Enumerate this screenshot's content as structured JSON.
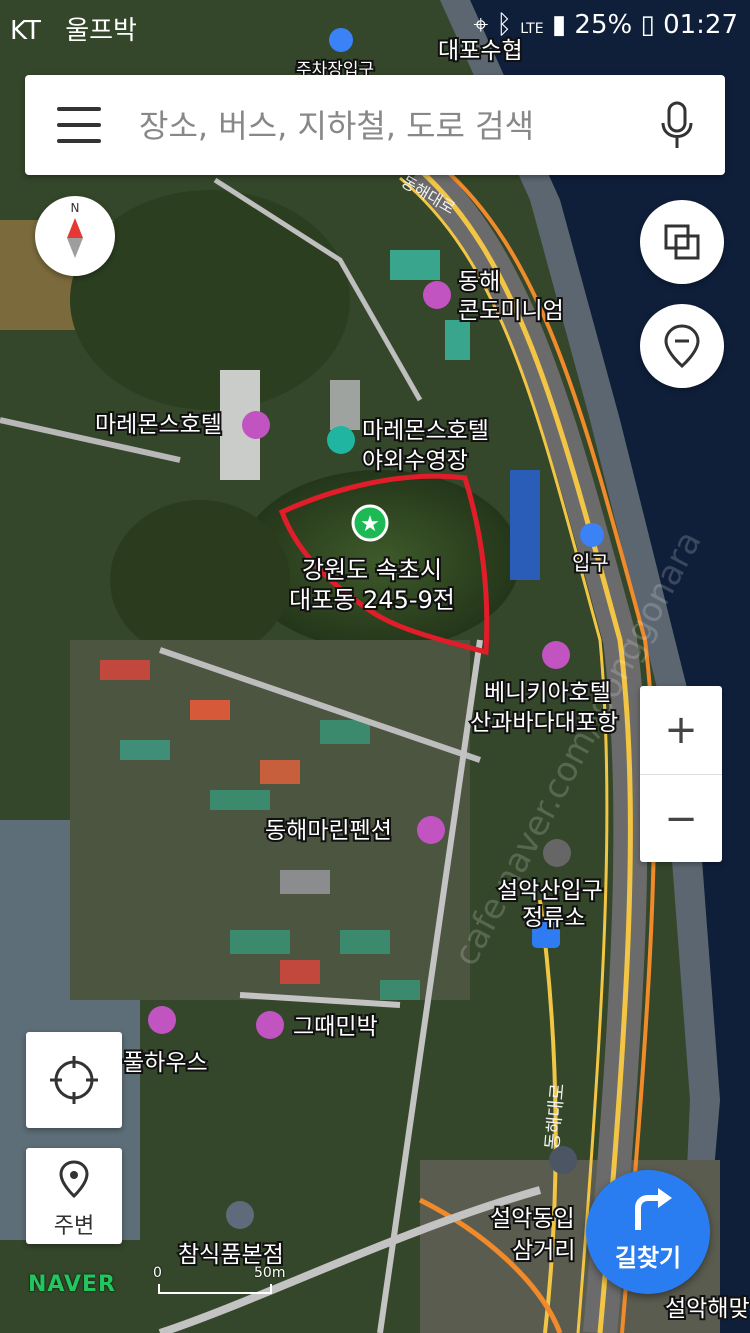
{
  "status_bar": {
    "carrier": "KT",
    "notification": "울프박",
    "network": "LTE",
    "battery": "25%",
    "time": "01:27"
  },
  "search": {
    "placeholder": "장소, 버스, 지하철, 도로 검색"
  },
  "buttons": {
    "nearby": "주변",
    "directions": "길찾기",
    "zoom_in": "+",
    "zoom_out": "−"
  },
  "map": {
    "target_address_line1": "강원도 속초시",
    "target_address_line2": "대포동 245-9전",
    "places": [
      {
        "id": "parking",
        "label": "주차장입구",
        "icon": "parking-icon"
      },
      {
        "id": "daepo",
        "label": "대포수협",
        "icon": "none"
      },
      {
        "id": "donghae-condo-1",
        "label": "동해",
        "icon": "lodging-icon"
      },
      {
        "id": "donghae-condo-2",
        "label": "콘도미니엄",
        "icon": "none"
      },
      {
        "id": "maremons-hotel",
        "label": "마레몬스호텔",
        "icon": "hotel-icon"
      },
      {
        "id": "maremons-pool-1",
        "label": "마레몬스호텔",
        "icon": "pool-icon"
      },
      {
        "id": "maremons-pool-2",
        "label": "야외수영장",
        "icon": "none"
      },
      {
        "id": "entrance",
        "label": "입구",
        "icon": "entrance-icon"
      },
      {
        "id": "venezia-1",
        "label": "베니키아호텔",
        "icon": "hotel-icon"
      },
      {
        "id": "venezia-2",
        "label": "산과바다대포항",
        "icon": "none"
      },
      {
        "id": "donghae-pension",
        "label": "동해마린펜션",
        "icon": "lodging-icon"
      },
      {
        "id": "seorak-stop-1",
        "label": "설악산입구",
        "icon": "bus-icon"
      },
      {
        "id": "seorak-stop-2",
        "label": "정류소",
        "icon": "none"
      },
      {
        "id": "geuttae",
        "label": "그때민박",
        "icon": "lodging-icon"
      },
      {
        "id": "pool-house",
        "label": "풀하우스",
        "icon": "lodging-icon"
      },
      {
        "id": "chamsik",
        "label": "참식품본점",
        "icon": "store-icon"
      },
      {
        "id": "seorakdong-1",
        "label": "설악동입",
        "icon": "none"
      },
      {
        "id": "seorakdong-2",
        "label": "삼거리",
        "icon": "none"
      },
      {
        "id": "seorak-beach",
        "label": "설악해맞",
        "icon": "none"
      }
    ],
    "roads": [
      "동해대로",
      "동해대로"
    ],
    "scale_labels": [
      "0",
      "50m"
    ],
    "watermark": "cafe.naver.com/joonggonara",
    "logo": "NAVER"
  },
  "colors": {
    "accent": "#2a7df1",
    "marker_outline": "#e11d2a",
    "pin_green": "#1db954",
    "poi_lodging": "#c254c2",
    "poi_pool": "#1fb5a0",
    "poi_bus": "#2f7cf2",
    "road_yellow": "#f2c544",
    "road_orange": "#f08a2a"
  }
}
